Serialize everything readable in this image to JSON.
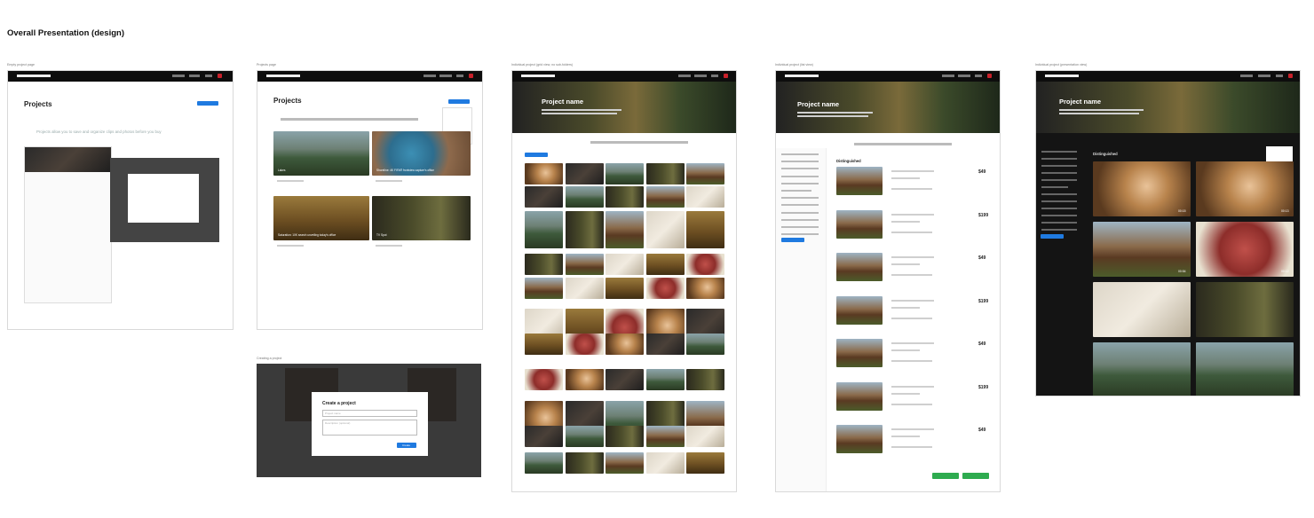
{
  "page": {
    "title": "Overall Presentation (design)"
  },
  "captions": {
    "empty": "Empty project page",
    "projects": "Projects page",
    "creating": "Creating a project",
    "grid": "Individual project (grid view, no sub-folders)",
    "list": "Individual project (list view)",
    "presentation": "Individual project (presentation view)"
  },
  "empty_page": {
    "heading": "Projects",
    "lead": "Projects allow you to save and organize clips and photos before you buy"
  },
  "projects_page": {
    "heading": "Projects",
    "cards": [
      {
        "label": "Lakes"
      },
      {
        "label": "Shoreline: 4K FIFA® frontview capture's office"
      },
      {
        "label": "Saturation: 10K search unveiling today's office"
      },
      {
        "label": "TV Spot"
      }
    ]
  },
  "create_modal": {
    "title": "Create a project",
    "name_placeholder": "Project name",
    "desc_placeholder": "Description (optional)",
    "create_label": "Create"
  },
  "project_views": {
    "grid": {
      "name": "Project name"
    },
    "list": {
      "name": "Project name",
      "section": "Distinguished"
    },
    "presentation": {
      "name": "Project name",
      "section": "Distinguished"
    }
  },
  "list_prices": [
    "$49",
    "$199",
    "$49",
    "$199",
    "$49",
    "$199",
    "$49"
  ],
  "presentation_durations": [
    "00:15",
    "00:13",
    "00:54",
    "00:12"
  ]
}
